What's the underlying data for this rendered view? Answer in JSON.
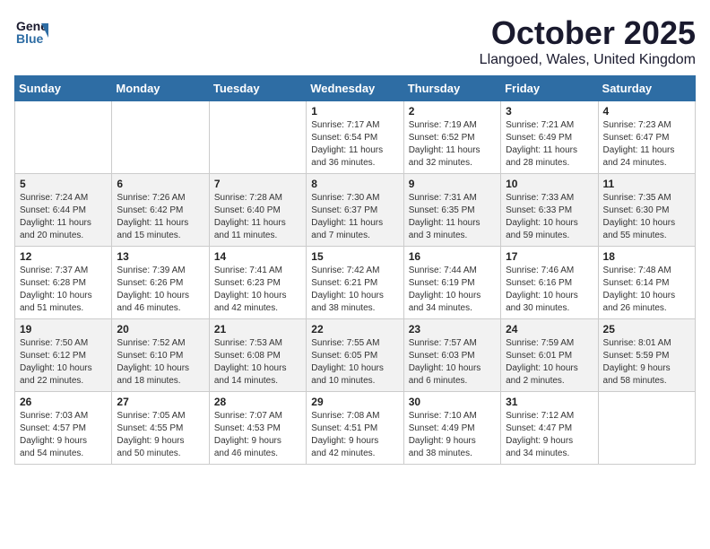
{
  "header": {
    "logo_line1": "General",
    "logo_line2": "Blue",
    "month": "October 2025",
    "location": "Llangoed, Wales, United Kingdom"
  },
  "weekdays": [
    "Sunday",
    "Monday",
    "Tuesday",
    "Wednesday",
    "Thursday",
    "Friday",
    "Saturday"
  ],
  "rows": [
    [
      {
        "day": "",
        "lines": []
      },
      {
        "day": "",
        "lines": []
      },
      {
        "day": "",
        "lines": []
      },
      {
        "day": "1",
        "lines": [
          "Sunrise: 7:17 AM",
          "Sunset: 6:54 PM",
          "Daylight: 11 hours",
          "and 36 minutes."
        ]
      },
      {
        "day": "2",
        "lines": [
          "Sunrise: 7:19 AM",
          "Sunset: 6:52 PM",
          "Daylight: 11 hours",
          "and 32 minutes."
        ]
      },
      {
        "day": "3",
        "lines": [
          "Sunrise: 7:21 AM",
          "Sunset: 6:49 PM",
          "Daylight: 11 hours",
          "and 28 minutes."
        ]
      },
      {
        "day": "4",
        "lines": [
          "Sunrise: 7:23 AM",
          "Sunset: 6:47 PM",
          "Daylight: 11 hours",
          "and 24 minutes."
        ]
      }
    ],
    [
      {
        "day": "5",
        "lines": [
          "Sunrise: 7:24 AM",
          "Sunset: 6:44 PM",
          "Daylight: 11 hours",
          "and 20 minutes."
        ]
      },
      {
        "day": "6",
        "lines": [
          "Sunrise: 7:26 AM",
          "Sunset: 6:42 PM",
          "Daylight: 11 hours",
          "and 15 minutes."
        ]
      },
      {
        "day": "7",
        "lines": [
          "Sunrise: 7:28 AM",
          "Sunset: 6:40 PM",
          "Daylight: 11 hours",
          "and 11 minutes."
        ]
      },
      {
        "day": "8",
        "lines": [
          "Sunrise: 7:30 AM",
          "Sunset: 6:37 PM",
          "Daylight: 11 hours",
          "and 7 minutes."
        ]
      },
      {
        "day": "9",
        "lines": [
          "Sunrise: 7:31 AM",
          "Sunset: 6:35 PM",
          "Daylight: 11 hours",
          "and 3 minutes."
        ]
      },
      {
        "day": "10",
        "lines": [
          "Sunrise: 7:33 AM",
          "Sunset: 6:33 PM",
          "Daylight: 10 hours",
          "and 59 minutes."
        ]
      },
      {
        "day": "11",
        "lines": [
          "Sunrise: 7:35 AM",
          "Sunset: 6:30 PM",
          "Daylight: 10 hours",
          "and 55 minutes."
        ]
      }
    ],
    [
      {
        "day": "12",
        "lines": [
          "Sunrise: 7:37 AM",
          "Sunset: 6:28 PM",
          "Daylight: 10 hours",
          "and 51 minutes."
        ]
      },
      {
        "day": "13",
        "lines": [
          "Sunrise: 7:39 AM",
          "Sunset: 6:26 PM",
          "Daylight: 10 hours",
          "and 46 minutes."
        ]
      },
      {
        "day": "14",
        "lines": [
          "Sunrise: 7:41 AM",
          "Sunset: 6:23 PM",
          "Daylight: 10 hours",
          "and 42 minutes."
        ]
      },
      {
        "day": "15",
        "lines": [
          "Sunrise: 7:42 AM",
          "Sunset: 6:21 PM",
          "Daylight: 10 hours",
          "and 38 minutes."
        ]
      },
      {
        "day": "16",
        "lines": [
          "Sunrise: 7:44 AM",
          "Sunset: 6:19 PM",
          "Daylight: 10 hours",
          "and 34 minutes."
        ]
      },
      {
        "day": "17",
        "lines": [
          "Sunrise: 7:46 AM",
          "Sunset: 6:16 PM",
          "Daylight: 10 hours",
          "and 30 minutes."
        ]
      },
      {
        "day": "18",
        "lines": [
          "Sunrise: 7:48 AM",
          "Sunset: 6:14 PM",
          "Daylight: 10 hours",
          "and 26 minutes."
        ]
      }
    ],
    [
      {
        "day": "19",
        "lines": [
          "Sunrise: 7:50 AM",
          "Sunset: 6:12 PM",
          "Daylight: 10 hours",
          "and 22 minutes."
        ]
      },
      {
        "day": "20",
        "lines": [
          "Sunrise: 7:52 AM",
          "Sunset: 6:10 PM",
          "Daylight: 10 hours",
          "and 18 minutes."
        ]
      },
      {
        "day": "21",
        "lines": [
          "Sunrise: 7:53 AM",
          "Sunset: 6:08 PM",
          "Daylight: 10 hours",
          "and 14 minutes."
        ]
      },
      {
        "day": "22",
        "lines": [
          "Sunrise: 7:55 AM",
          "Sunset: 6:05 PM",
          "Daylight: 10 hours",
          "and 10 minutes."
        ]
      },
      {
        "day": "23",
        "lines": [
          "Sunrise: 7:57 AM",
          "Sunset: 6:03 PM",
          "Daylight: 10 hours",
          "and 6 minutes."
        ]
      },
      {
        "day": "24",
        "lines": [
          "Sunrise: 7:59 AM",
          "Sunset: 6:01 PM",
          "Daylight: 10 hours",
          "and 2 minutes."
        ]
      },
      {
        "day": "25",
        "lines": [
          "Sunrise: 8:01 AM",
          "Sunset: 5:59 PM",
          "Daylight: 9 hours",
          "and 58 minutes."
        ]
      }
    ],
    [
      {
        "day": "26",
        "lines": [
          "Sunrise: 7:03 AM",
          "Sunset: 4:57 PM",
          "Daylight: 9 hours",
          "and 54 minutes."
        ]
      },
      {
        "day": "27",
        "lines": [
          "Sunrise: 7:05 AM",
          "Sunset: 4:55 PM",
          "Daylight: 9 hours",
          "and 50 minutes."
        ]
      },
      {
        "day": "28",
        "lines": [
          "Sunrise: 7:07 AM",
          "Sunset: 4:53 PM",
          "Daylight: 9 hours",
          "and 46 minutes."
        ]
      },
      {
        "day": "29",
        "lines": [
          "Sunrise: 7:08 AM",
          "Sunset: 4:51 PM",
          "Daylight: 9 hours",
          "and 42 minutes."
        ]
      },
      {
        "day": "30",
        "lines": [
          "Sunrise: 7:10 AM",
          "Sunset: 4:49 PM",
          "Daylight: 9 hours",
          "and 38 minutes."
        ]
      },
      {
        "day": "31",
        "lines": [
          "Sunrise: 7:12 AM",
          "Sunset: 4:47 PM",
          "Daylight: 9 hours",
          "and 34 minutes."
        ]
      },
      {
        "day": "",
        "lines": []
      }
    ]
  ]
}
